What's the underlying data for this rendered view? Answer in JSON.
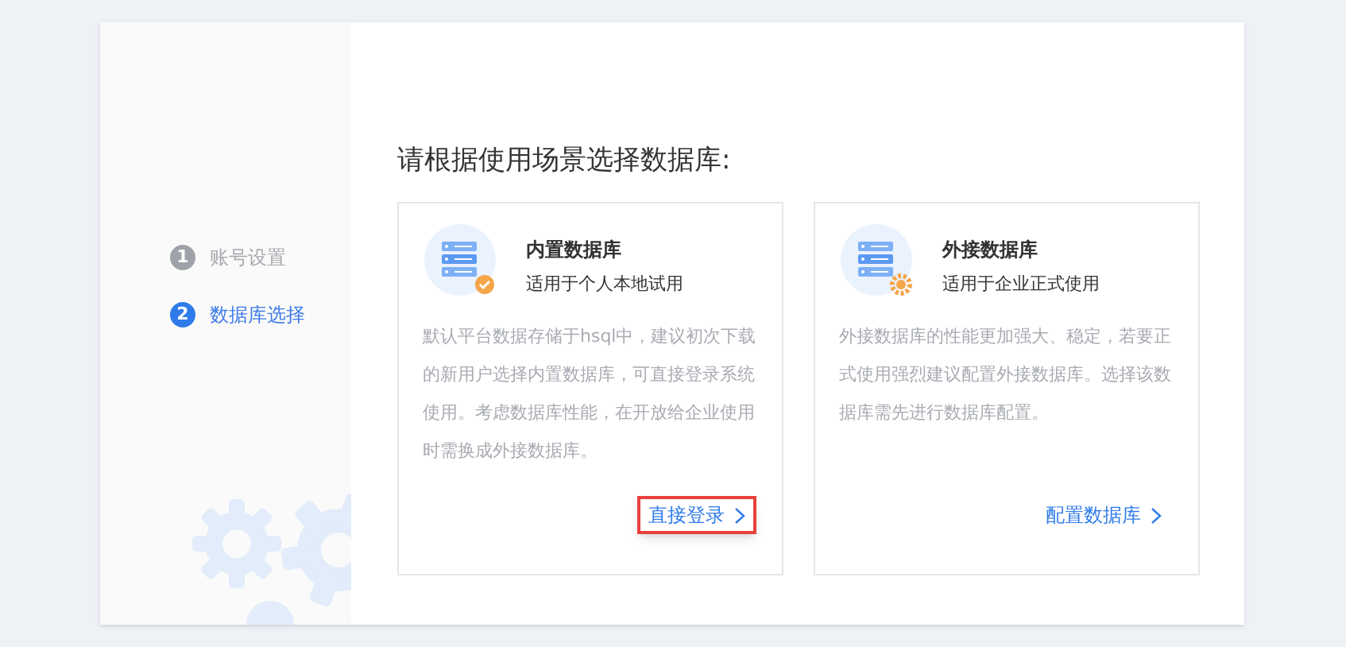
{
  "steps": [
    {
      "number": "1",
      "label": "账号设置",
      "selected": false
    },
    {
      "number": "2",
      "label": "数据库选择",
      "selected": true
    }
  ],
  "heading": "请根据使用场景选择数据库:",
  "cards": [
    {
      "title": "内置数据库",
      "subtitle": "适用于个人本地试用",
      "kind": "builtin",
      "description": "默认平台数据存储于hsql中，建议初次下载的新用户选择内置数据库，可直接登录系统使用。考虑数据库性能，在开放给企业使用时需换成外接数据库。",
      "action": "直接登录",
      "highlighted": true
    },
    {
      "title": "外接数据库",
      "subtitle": "适用于企业正式使用",
      "kind": "external",
      "description": "外接数据库的性能更加强大、稳定，若要正式使用强烈建议配置外接数据库。选择该数据库需先进行数据库配置。",
      "action": "配置数据库",
      "highlighted": false
    }
  ]
}
